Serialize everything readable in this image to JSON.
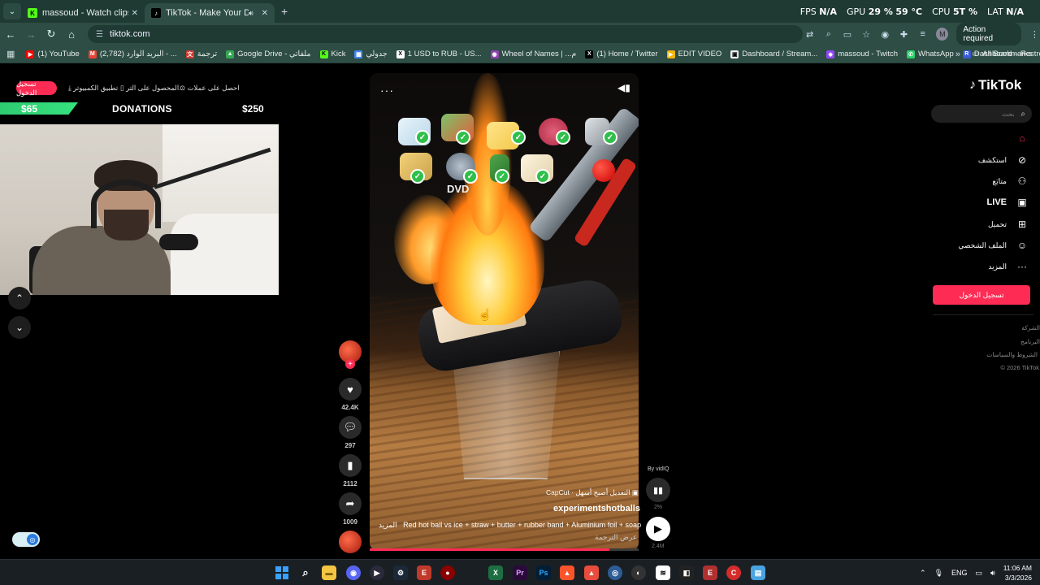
{
  "browser": {
    "tabs": [
      {
        "title": "massoud - Watch clips on Kick",
        "favicon": "kick-icon",
        "active": false
      },
      {
        "title": "TikTok - Make Your Day",
        "favicon": "tiktok-icon",
        "active": true
      }
    ],
    "url": "tiktok.com",
    "action_required": "Action required",
    "profile_initial": "M",
    "overlay_stats": {
      "fps_label": "FPS",
      "fps_value": "N/A",
      "gpu_label": "GPU",
      "gpu_value": "29 %",
      "gpu_temp": "59 °C",
      "cpu_label": "CPU",
      "cpu_value": "5T %",
      "lat_label": "LAT",
      "lat_value": "N/A"
    },
    "bookmarks": [
      {
        "label": "(1) YouTube",
        "color": "#ff0000",
        "glyph": "▶"
      },
      {
        "label": "(2,782) البريد الوارد - ...",
        "color": "#ea4335",
        "glyph": "M"
      },
      {
        "label": "ترجمة",
        "color": "#d23a2e",
        "glyph": "文"
      },
      {
        "label": "Google Drive - ملفاتي",
        "color": "#34a853",
        "glyph": "▲"
      },
      {
        "label": "Kick",
        "color": "#53fc18",
        "glyph": "K"
      },
      {
        "label": "جدولي",
        "color": "#4285f4",
        "glyph": "▦"
      },
      {
        "label": "1 USD to RUB - US...",
        "color": "#ffffff",
        "glyph": "X"
      },
      {
        "label": "Wheel of Names | ...م",
        "color": "#8e44ad",
        "glyph": "◉"
      },
      {
        "label": "(1) Home / Twitter",
        "color": "#000000",
        "glyph": "X"
      },
      {
        "label": "EDIT VIDEO",
        "color": "#f4b400",
        "glyph": "▶"
      },
      {
        "label": "Dashboard / Stream...",
        "color": "#eeeeee",
        "glyph": "▣"
      },
      {
        "label": "massoud - Twitch",
        "color": "#9146ff",
        "glyph": "◆"
      },
      {
        "label": "WhatsApp",
        "color": "#25d366",
        "glyph": "✆"
      },
      {
        "label": "Dashboard – Restre...",
        "color": "#3a5bd9",
        "glyph": "R"
      }
    ],
    "all_bookmarks": "All Bookmarks"
  },
  "stream_overlay": {
    "header_login": "تسجيل الدخول",
    "header_links": [
      "احصل على عملات",
      "المحصول على التر...",
      "تطبيق الكمبيوتر"
    ],
    "donation": {
      "current": "$65",
      "title": "DONATIONS",
      "goal": "$250",
      "progress": 0.26
    }
  },
  "video": {
    "dvd_label": "DVD",
    "capcut": "CapCut · التعديل أصبح أسهل",
    "author": "experimentshotballs",
    "caption": "Red hot ball vs ice + straw + butter + rubber band + Aluminium foil + soap",
    "caption_more": "المزيد",
    "see_translation": "عرض الترجمة",
    "progress": 0.89
  },
  "actions": {
    "likes": "42.4K",
    "comments": "297",
    "saves": "2112",
    "shares": "1009"
  },
  "vidiq": {
    "by": "By vidIQ",
    "pct": "2%",
    "views": "2.4M"
  },
  "sidebar": {
    "logo": "TikTok",
    "search_placeholder": "بحث",
    "nav": [
      {
        "label": "",
        "icon": "home-icon",
        "active": true
      },
      {
        "label": "استكشف",
        "icon": "compass-icon",
        "active": false
      },
      {
        "label": "متابَع",
        "icon": "following-icon",
        "active": false
      },
      {
        "label": "LIVE",
        "icon": "live-icon",
        "active": false
      },
      {
        "label": "تحميل",
        "icon": "upload-icon",
        "active": false
      },
      {
        "label": "الملف الشخصي",
        "icon": "profile-icon",
        "active": false
      },
      {
        "label": "المزيد",
        "icon": "more-icon",
        "active": false
      }
    ],
    "login_button": "تسجيل الدخول",
    "footer": [
      "الشركة",
      "البرنامج",
      "الشروط والسياسات",
      "© 2026 TikTok"
    ]
  },
  "taskbar": {
    "language": "ENG",
    "time": "11:06 AM",
    "date": "3/3/2026"
  }
}
